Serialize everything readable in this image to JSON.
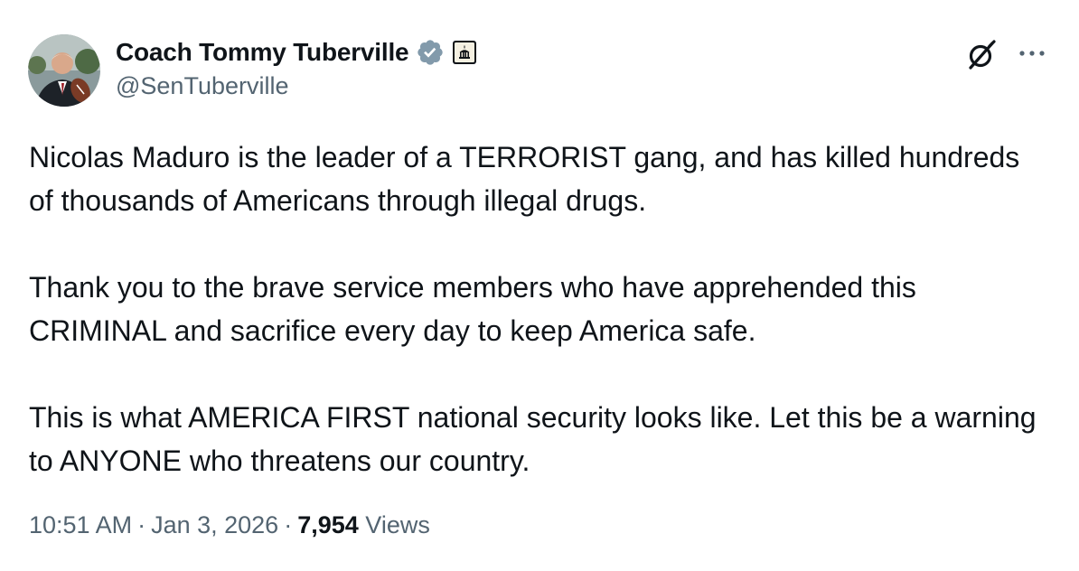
{
  "author": {
    "display_name": "Coach Tommy Tuberville",
    "handle": "@SenTuberville",
    "avatar_icon": "profile-photo",
    "verified_color": "#829aab",
    "badge_icon": "us-capitol-icon"
  },
  "post": {
    "paragraphs": [
      "Nicolas Maduro is the leader of a TERRORIST gang, and has killed hundreds of thousands of Americans through illegal drugs.",
      "Thank you to the brave service members who have apprehended this CRIMINAL and sacrifice every day to keep America safe.",
      "This is what AMERICA FIRST national security looks like. Let this be a warning to ANYONE who threatens our country."
    ]
  },
  "meta": {
    "time": "10:51 AM",
    "separator": "·",
    "date": "Jan 3, 2026",
    "view_count": "7,954",
    "views_label": "Views"
  },
  "actions": {
    "grok_icon": "grok-icon",
    "more_icon": "more-options-icon"
  }
}
